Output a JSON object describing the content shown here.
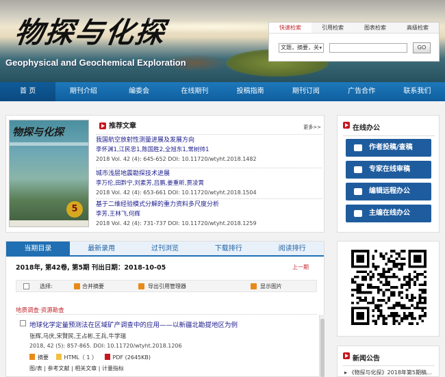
{
  "header": {
    "logo_cn": "物探与化探",
    "logo_reg": "®",
    "logo_en": "Geophysical and Geochemical Exploration"
  },
  "search": {
    "tabs": [
      "快速检索",
      "引用检索",
      "图表检索",
      "高级检索"
    ],
    "field_selected": "文题，摘要，关",
    "go_label": "GO"
  },
  "nav": {
    "items": [
      "首 页",
      "期刊介绍",
      "编委会",
      "在线期刊",
      "投稿指南",
      "期刊订阅",
      "广告合作",
      "联系我们"
    ]
  },
  "featured": {
    "cover_title": "物探与化探",
    "cover_issue": "5",
    "title": "推荐文章",
    "more": "更多>>",
    "articles": [
      {
        "title": "我国航空放射性测量进展及发展方向",
        "authors": "李怀渊1,江民忠1,陈国胜2,全旭东1,常树帅1",
        "meta": "2018 Vol. 42 (4): 645-652   DOI: 10.11720/wtyht.2018.1482"
      },
      {
        "title": "城市浅层地震勘探技术进展",
        "authors": "李万伦,田黔宁,刘素芳,吕鹏,姜重昕,贾凌霄",
        "meta": "2018 Vol. 42 (4): 653-661   DOI: 10.11720/wtyht.2018.1504"
      },
      {
        "title": "基于二维经验模式分解的重力资料多尺度分析",
        "authors": "李芳,王林飞,何辉",
        "meta": "2018 Vol. 42 (4): 731-737   DOI: 10.11720/wtyht.2018.1259"
      }
    ]
  },
  "issue": {
    "tabs": [
      "当期目录",
      "最新录用",
      "过刊浏览",
      "下载排行",
      "阅读排行"
    ],
    "info": "2018年, 第42卷, 第5期   刊出日期：2018-10-05",
    "prev": "上一期",
    "toolbar": {
      "select": "选择:",
      "merge": "合并摘要",
      "export": "导出引用管理器",
      "show_images": "显示图片"
    },
    "section": "地质调查·资源勘查",
    "article": {
      "title": "地球化学定量预测法在区域矿产调查中的应用——以新疆北勘提地区为例",
      "authors": "张辉,马庆,宋賢民,王占彬,王兵,牛学瑞",
      "meta": "2018, 42 (5): 857-865.  DOI: 10.11720/wtyht.2018.1206",
      "abstract": "摘要",
      "html": "HTML（ 1 ）",
      "pdf": "PDF (2645KB)",
      "tail": "图/表 | 参考文献 | 相关文章 | 计量指标"
    }
  },
  "office": {
    "title": "在线办公",
    "buttons": [
      "作者投稿/查稿",
      "专家在线审稿",
      "编辑远程办公",
      "主编在线办公"
    ]
  },
  "news": {
    "title": "新闻公告",
    "item": "《物探与化探》2018年第5期稿..."
  },
  "colors": {
    "nav_blue": "#1d78bb",
    "accent_red": "#c8161d",
    "button_blue": "#1f5c9e"
  }
}
